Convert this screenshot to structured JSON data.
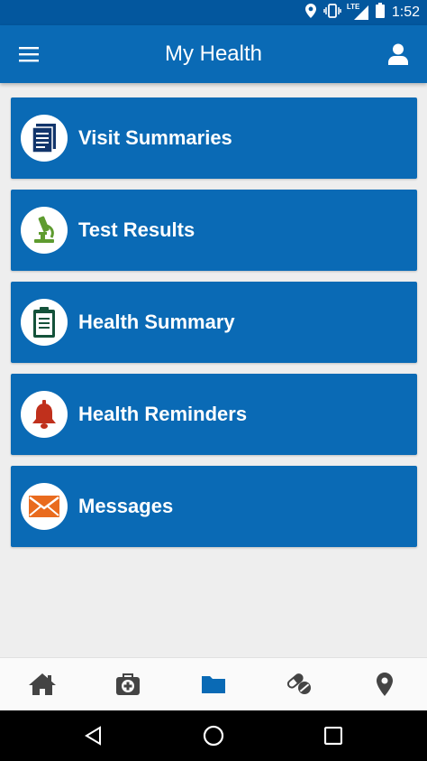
{
  "status_bar": {
    "time": "1:52",
    "network": "LTE"
  },
  "app_bar": {
    "title": "My Health"
  },
  "menu": [
    {
      "id": "visit-summaries",
      "label": "Visit Summaries",
      "icon": "document-icon"
    },
    {
      "id": "test-results",
      "label": "Test Results",
      "icon": "microscope-icon"
    },
    {
      "id": "health-summary",
      "label": "Health Summary",
      "icon": "clipboard-icon"
    },
    {
      "id": "health-reminders",
      "label": "Health Reminders",
      "icon": "bell-icon"
    },
    {
      "id": "messages",
      "label": "Messages",
      "icon": "envelope-icon"
    }
  ],
  "bottom_nav": [
    {
      "id": "home",
      "icon": "home-icon",
      "active": false
    },
    {
      "id": "care",
      "icon": "medical-bag-icon",
      "active": false
    },
    {
      "id": "health-records",
      "icon": "folder-icon",
      "active": true
    },
    {
      "id": "medications",
      "icon": "pills-icon",
      "active": false
    },
    {
      "id": "locations",
      "icon": "location-pin-icon",
      "active": false
    }
  ],
  "colors": {
    "app_bar": "#0a6ab5",
    "status_bar": "#03579e",
    "card": "#0a6ab5",
    "background": "#eeeeee",
    "nav_active": "#0a6ab5",
    "nav_inactive": "#444444"
  }
}
